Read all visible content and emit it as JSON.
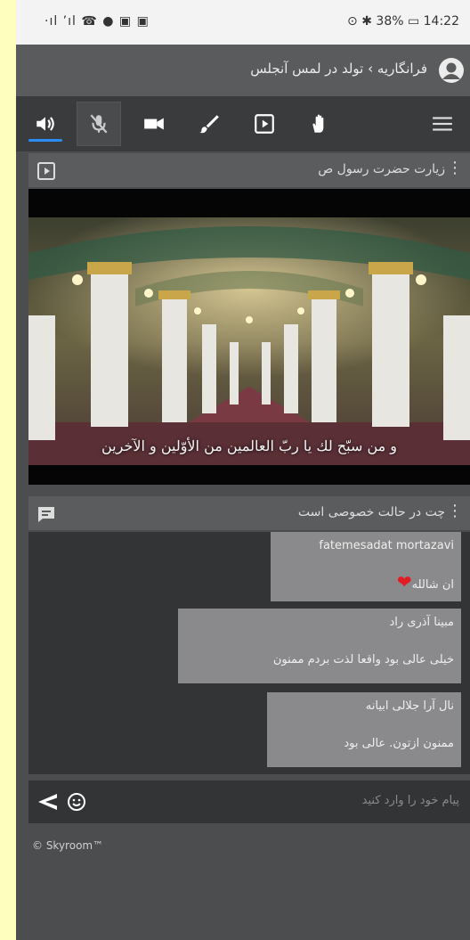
{
  "statusbar": {
    "left_text": "·ıl ’ıl ☎ ● ▣ ▣",
    "right_text": "⊙ ✱ 38% ▭ 14:22"
  },
  "header": {
    "breadcrumb": "فرانگاریه › تولد در لمس آنجلس",
    "avatar_icon": "user-circle-icon"
  },
  "toolbar": {
    "items": [
      {
        "name": "speaker-icon",
        "active": true
      },
      {
        "name": "mic-muted-icon",
        "active": false
      },
      {
        "name": "camera-icon",
        "active": false
      },
      {
        "name": "brush-icon",
        "active": false
      },
      {
        "name": "media-play-icon",
        "active": false
      },
      {
        "name": "raise-hand-icon",
        "active": false
      },
      {
        "name": "menu-icon",
        "active": false
      }
    ],
    "accent_color": "#2a8df5"
  },
  "video_panel": {
    "title": "زیارت حضرت رسول ص",
    "caption": "و من سبّح لك يا ربّ العالمين من الأوّلين و الآخرين"
  },
  "chat_panel": {
    "title": "چت در حالت خصوصی است",
    "messages": [
      {
        "from": "fatemesadat mortazavi",
        "text": "ان شالله",
        "emoji": "❤"
      },
      {
        "from": "مبینا آذری راد",
        "text": "خیلی عالی بود واقعا لذت بردم ممنون"
      },
      {
        "from": "نال آرا جلالی ابیانه",
        "text": "ممنون ازتون. عالی بود"
      }
    ],
    "input_placeholder": "پیام خود را وارد کنید"
  },
  "footer": {
    "copyright": "© Skyroom™"
  }
}
